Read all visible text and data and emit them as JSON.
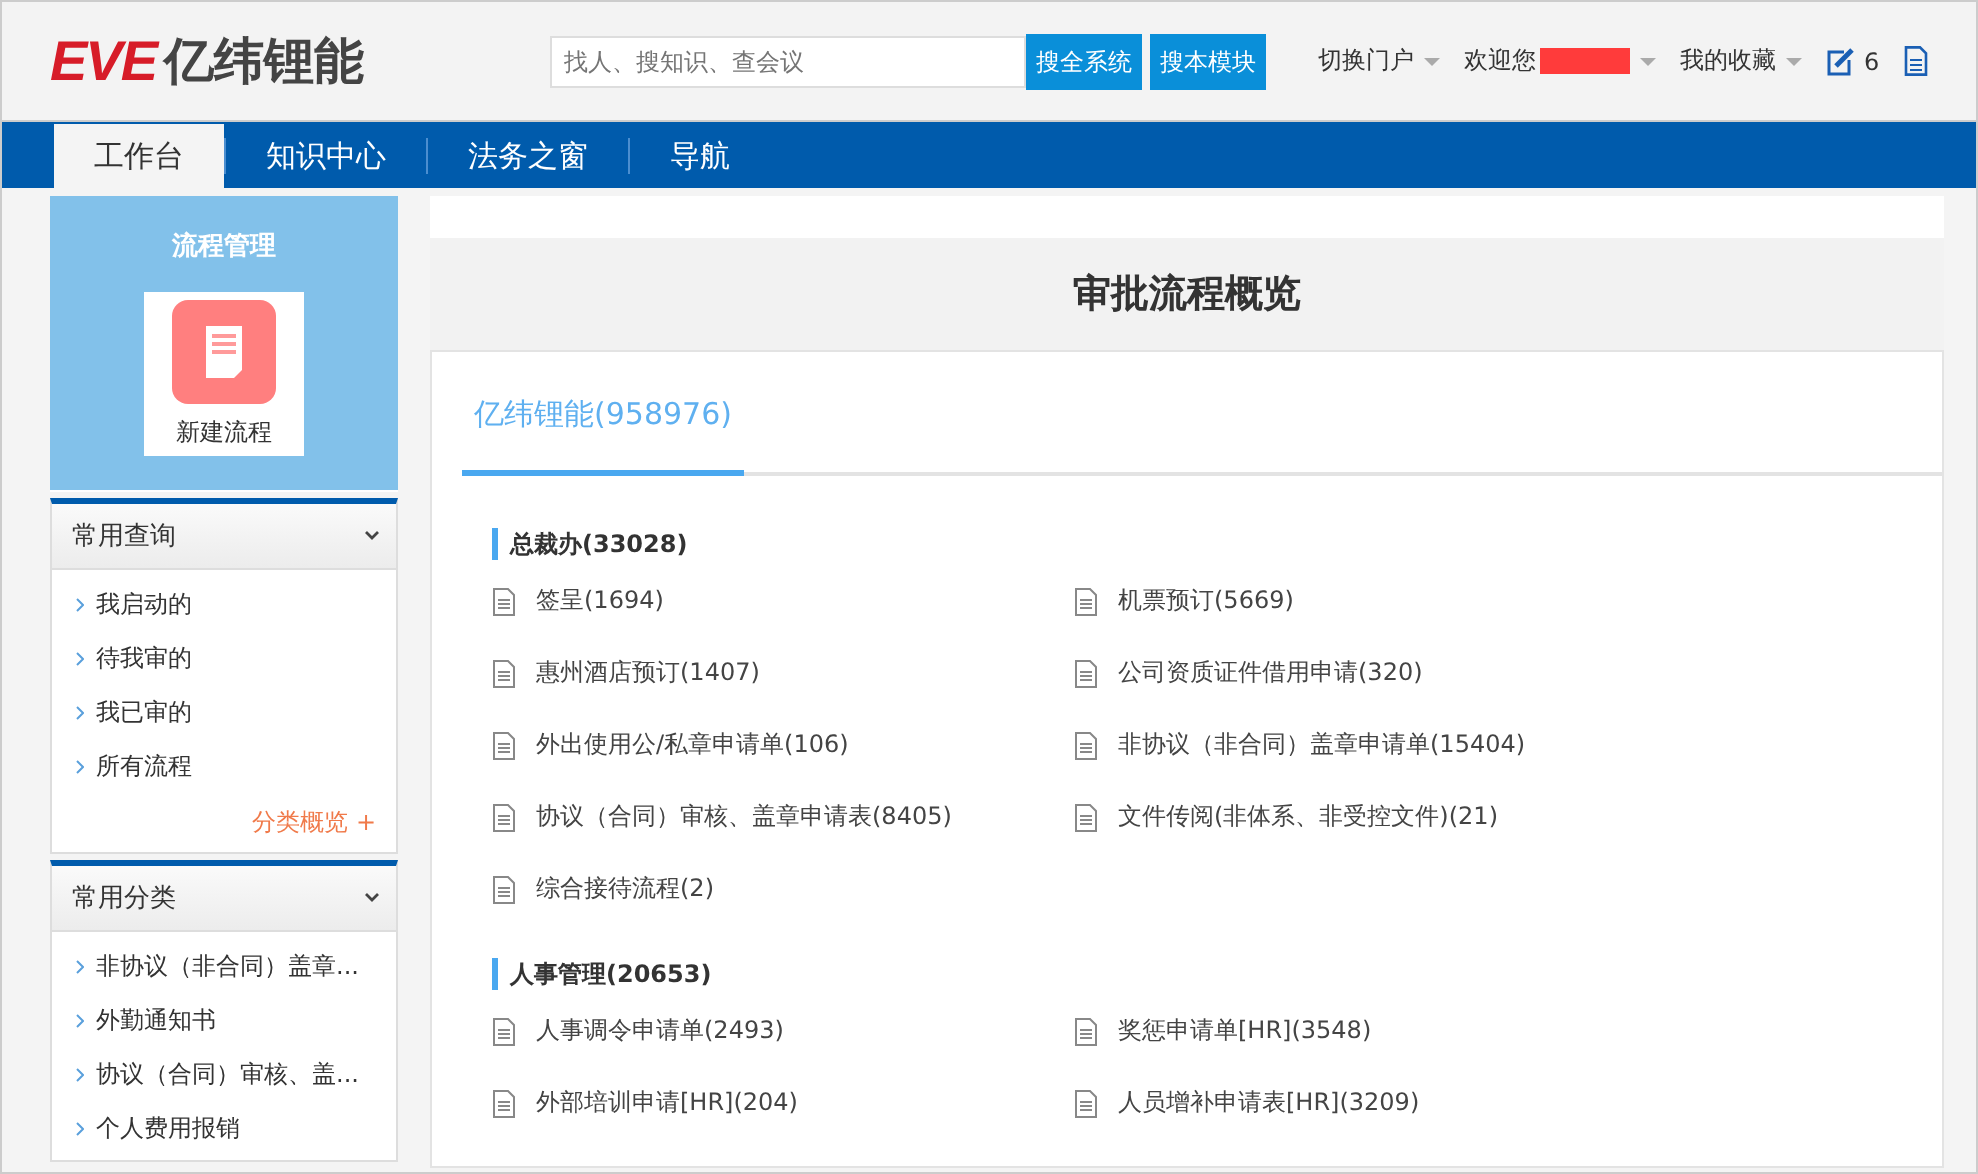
{
  "header": {
    "logo_mark": "EVE",
    "logo_text": "亿纬锂能",
    "search": {
      "placeholder": "找人、搜知识、查会议"
    },
    "search_buttons": [
      "搜全系统",
      "搜本模块"
    ],
    "menus": [
      {
        "label": "切换门户",
        "redacted": false
      },
      {
        "label": "欢迎您",
        "redacted": true
      },
      {
        "label": "我的收藏",
        "redacted": false
      }
    ],
    "notice_count": "6"
  },
  "nav": {
    "tabs": [
      {
        "label": "工作台",
        "selected": true
      },
      {
        "label": "知识中心",
        "selected": false
      },
      {
        "label": "法务之窗",
        "selected": false
      },
      {
        "label": "导航",
        "selected": false
      }
    ]
  },
  "sidebar": {
    "module_title": "流程管理",
    "new_button": "新建流程",
    "sections": [
      {
        "title": "常用查询",
        "expanded": true,
        "items": [
          "我启动的",
          "待我审的",
          "我已审的",
          "所有流程"
        ],
        "more_link": "分类概览 +"
      },
      {
        "title": "常用分类",
        "expanded": true,
        "items": [
          "非协议（非合同）盖章...",
          "外勤通知书",
          "协议（合同）审核、盖...",
          "个人费用报销"
        ]
      }
    ]
  },
  "main": {
    "title": "审批流程概览",
    "tabs": [
      {
        "label": "亿纬锂能(958976)",
        "selected": true
      }
    ],
    "groups": [
      {
        "title": "总裁办(33028)",
        "items": [
          "签呈(1694)",
          "机票预订(5669)",
          "惠州酒店预订(1407)",
          "公司资质证件借用申请(320)",
          "外出使用公/私章申请单(106)",
          "非协议（非合同）盖章申请单(15404)",
          "协议（合同）审核、盖章申请表(8405)",
          "文件传阅(非体系、非受控文件)(21)",
          "综合接待流程(2)"
        ]
      },
      {
        "title": "人事管理(20653)",
        "items": [
          "人事调令申请单(2493)",
          "奖惩申请单[HR](3548)",
          "外部培训申请[HR](204)",
          "人员增补申请表[HR](3209)"
        ]
      }
    ]
  }
}
